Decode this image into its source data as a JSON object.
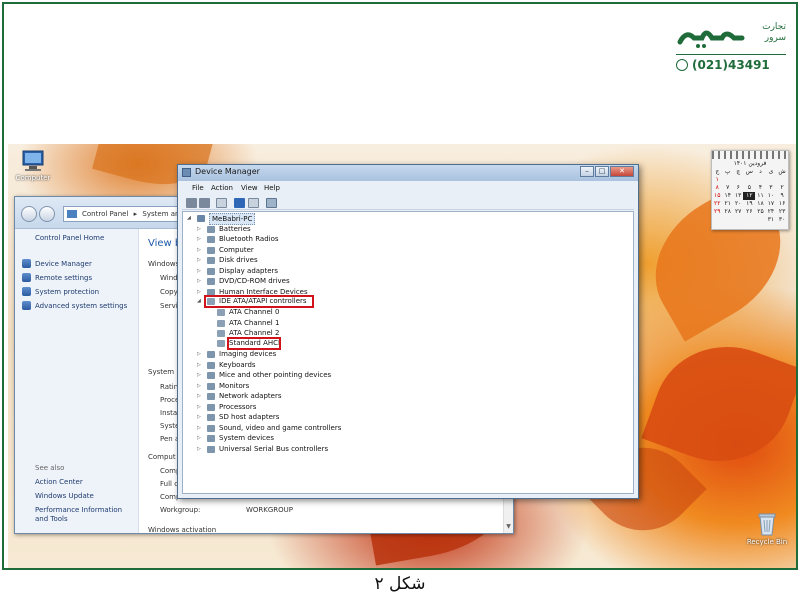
{
  "logo": {
    "brand_text": "پارسه",
    "tagline_line1": "تجارت",
    "tagline_line2": "سرور",
    "phone": "(021)43491",
    "brand_color": "#1f6b3a"
  },
  "desktop": {
    "icons": {
      "computer": "Computer",
      "recycle_bin": "Recycle Bin"
    },
    "calendar": {
      "title": "فرودین ۱۴۰۱",
      "rows": [
        [
          "ش",
          "ی",
          "د",
          "س",
          "چ",
          "پ",
          "ج"
        ],
        [
          "",
          "",
          "",
          "",
          "",
          "",
          "۱"
        ],
        [
          "۲",
          "۳",
          "۴",
          "۵",
          "۶",
          "۷",
          "۸"
        ],
        [
          "۹",
          "۱۰",
          "۱۱",
          "۱۲",
          "۱۳",
          "۱۴",
          "۱۵"
        ],
        [
          "۱۶",
          "۱۷",
          "۱۸",
          "۱۹",
          "۲۰",
          "۲۱",
          "۲۲"
        ],
        [
          "۲۳",
          "۲۴",
          "۲۵",
          "۲۶",
          "۲۷",
          "۲۸",
          "۲۹"
        ],
        [
          "۳۰",
          "۳۱",
          "",
          "",
          "",
          "",
          ""
        ]
      ]
    }
  },
  "control_panel": {
    "breadcrumb_1": "Control Panel",
    "breadcrumb_sep": "▸",
    "breadcrumb_2": "System and",
    "home_link": "Control Panel Home",
    "tasks": [
      "Device Manager",
      "Remote settings",
      "System protection",
      "Advanced system settings"
    ],
    "see_also_label": "See also",
    "see_also": [
      "Action Center",
      "Windows Update",
      "Performance Information and Tools"
    ],
    "main": {
      "view_title": "View ba",
      "windows_edition_label": "Windows",
      "windows_edition_rows": [
        "Windo",
        "Copyr",
        "Servic"
      ],
      "system_label": "System",
      "system_rows": [
        "Rating",
        "Proce",
        "Install",
        "Syster",
        "Pen ar"
      ],
      "computer_label": "Comput",
      "computer_rows": [
        "Comp",
        "Full co",
        "Comp"
      ],
      "workgroup_label": "Workgroup:",
      "workgroup_value": "WORKGROUP",
      "activation_label": "Windows activation"
    }
  },
  "device_manager": {
    "title": "Device Manager",
    "menu": [
      "File",
      "Action",
      "View",
      "Help"
    ],
    "root": "MeBabri-PC",
    "categories_before": [
      "Batteries",
      "Bluetooth Radios",
      "Computer",
      "Disk drives",
      "Display adapters",
      "DVD/CD-ROM drives",
      "Human Interface Devices"
    ],
    "ide_category": "IDE ATA/ATAPI controllers",
    "ide_children": [
      "ATA Channel 0",
      "ATA Channel 1",
      "ATA Channel 2"
    ],
    "ide_ahci": "Standard AHCI",
    "categories_after": [
      "Imaging devices",
      "Keyboards",
      "Mice and other pointing devices",
      "Monitors",
      "Network adapters",
      "Processors",
      "SD host adapters",
      "Sound, video and game controllers",
      "System devices",
      "Universal Serial Bus controllers"
    ],
    "highlight_color": "#d0121b"
  },
  "caption": "شکل ۲"
}
